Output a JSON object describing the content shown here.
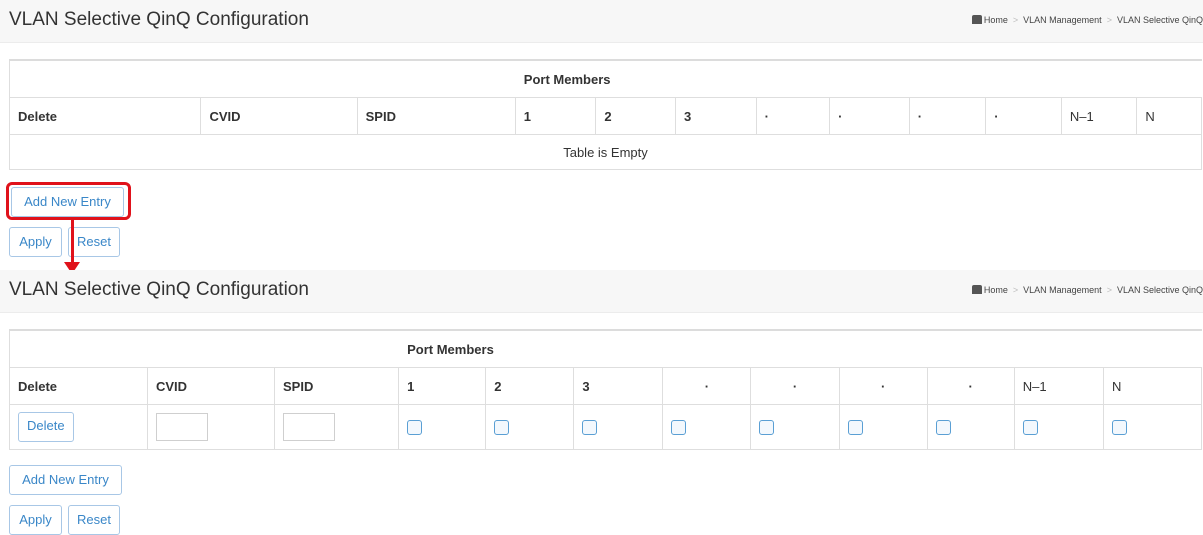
{
  "panels": [
    {
      "title": "VLAN Selective QinQ Configuration",
      "breadcrumb": [
        "Home",
        "VLAN Management",
        "VLAN Selective QinQ"
      ],
      "port_members_label": "Port Members",
      "columns": [
        "Delete",
        "CVID",
        "SPID",
        "1",
        "2",
        "3",
        "·",
        "·",
        "·",
        "·",
        "N–1",
        "N"
      ],
      "empty_message": "Table is Empty",
      "add_button": "Add New Entry",
      "apply_button": "Apply",
      "reset_button": "Reset"
    },
    {
      "title": "VLAN Selective QinQ Configuration",
      "breadcrumb": [
        "Home",
        "VLAN Management",
        "VLAN Selective QinQ"
      ],
      "port_members_label": "Port Members",
      "columns": [
        "Delete",
        "CVID",
        "SPID",
        "1",
        "2",
        "3",
        "·",
        "·",
        "·",
        "·",
        "N–1",
        "N"
      ],
      "row_delete_button": "Delete",
      "row_cvid_value": "",
      "row_spid_value": "",
      "add_button": "Add New Entry",
      "apply_button": "Apply",
      "reset_button": "Reset"
    }
  ],
  "annotation": {
    "color": "#e0121b"
  },
  "colors": {
    "button_text": "#3a87c8",
    "button_border": "#a8c7e6",
    "header_bg": "#f7f7f7"
  }
}
